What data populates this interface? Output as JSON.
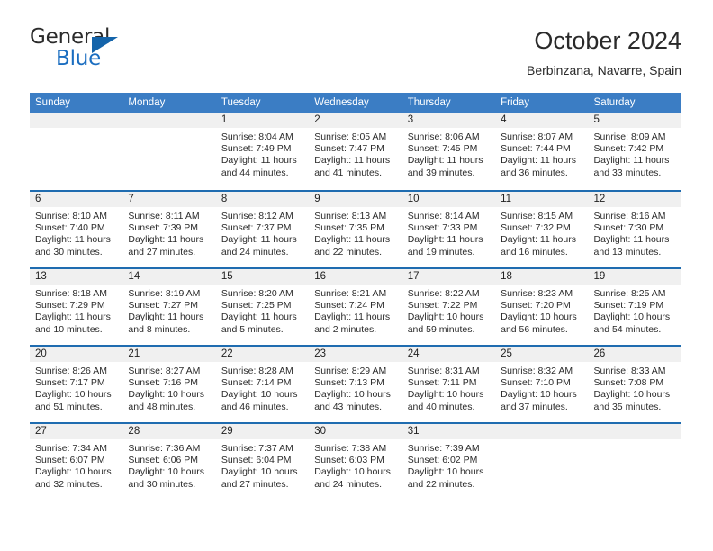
{
  "brand": {
    "name_part1": "General",
    "name_part2": "Blue",
    "accent_color": "#1a6dc0",
    "triangle_color": "#1464aa"
  },
  "header": {
    "month_title": "October 2024",
    "location": "Berbinzana, Navarre, Spain"
  },
  "calendar": {
    "header_bg": "#3b7dc4",
    "week_separator_color": "#1f6cb0",
    "day_number_bg": "#f0f0f0",
    "weekdays": [
      "Sunday",
      "Monday",
      "Tuesday",
      "Wednesday",
      "Thursday",
      "Friday",
      "Saturday"
    ],
    "weeks": [
      [
        {
          "empty": true
        },
        {
          "empty": true
        },
        {
          "day": "1",
          "sunrise": "Sunrise: 8:04 AM",
          "sunset": "Sunset: 7:49 PM",
          "daylight": "Daylight: 11 hours and 44 minutes."
        },
        {
          "day": "2",
          "sunrise": "Sunrise: 8:05 AM",
          "sunset": "Sunset: 7:47 PM",
          "daylight": "Daylight: 11 hours and 41 minutes."
        },
        {
          "day": "3",
          "sunrise": "Sunrise: 8:06 AM",
          "sunset": "Sunset: 7:45 PM",
          "daylight": "Daylight: 11 hours and 39 minutes."
        },
        {
          "day": "4",
          "sunrise": "Sunrise: 8:07 AM",
          "sunset": "Sunset: 7:44 PM",
          "daylight": "Daylight: 11 hours and 36 minutes."
        },
        {
          "day": "5",
          "sunrise": "Sunrise: 8:09 AM",
          "sunset": "Sunset: 7:42 PM",
          "daylight": "Daylight: 11 hours and 33 minutes."
        }
      ],
      [
        {
          "day": "6",
          "sunrise": "Sunrise: 8:10 AM",
          "sunset": "Sunset: 7:40 PM",
          "daylight": "Daylight: 11 hours and 30 minutes."
        },
        {
          "day": "7",
          "sunrise": "Sunrise: 8:11 AM",
          "sunset": "Sunset: 7:39 PM",
          "daylight": "Daylight: 11 hours and 27 minutes."
        },
        {
          "day": "8",
          "sunrise": "Sunrise: 8:12 AM",
          "sunset": "Sunset: 7:37 PM",
          "daylight": "Daylight: 11 hours and 24 minutes."
        },
        {
          "day": "9",
          "sunrise": "Sunrise: 8:13 AM",
          "sunset": "Sunset: 7:35 PM",
          "daylight": "Daylight: 11 hours and 22 minutes."
        },
        {
          "day": "10",
          "sunrise": "Sunrise: 8:14 AM",
          "sunset": "Sunset: 7:33 PM",
          "daylight": "Daylight: 11 hours and 19 minutes."
        },
        {
          "day": "11",
          "sunrise": "Sunrise: 8:15 AM",
          "sunset": "Sunset: 7:32 PM",
          "daylight": "Daylight: 11 hours and 16 minutes."
        },
        {
          "day": "12",
          "sunrise": "Sunrise: 8:16 AM",
          "sunset": "Sunset: 7:30 PM",
          "daylight": "Daylight: 11 hours and 13 minutes."
        }
      ],
      [
        {
          "day": "13",
          "sunrise": "Sunrise: 8:18 AM",
          "sunset": "Sunset: 7:29 PM",
          "daylight": "Daylight: 11 hours and 10 minutes."
        },
        {
          "day": "14",
          "sunrise": "Sunrise: 8:19 AM",
          "sunset": "Sunset: 7:27 PM",
          "daylight": "Daylight: 11 hours and 8 minutes."
        },
        {
          "day": "15",
          "sunrise": "Sunrise: 8:20 AM",
          "sunset": "Sunset: 7:25 PM",
          "daylight": "Daylight: 11 hours and 5 minutes."
        },
        {
          "day": "16",
          "sunrise": "Sunrise: 8:21 AM",
          "sunset": "Sunset: 7:24 PM",
          "daylight": "Daylight: 11 hours and 2 minutes."
        },
        {
          "day": "17",
          "sunrise": "Sunrise: 8:22 AM",
          "sunset": "Sunset: 7:22 PM",
          "daylight": "Daylight: 10 hours and 59 minutes."
        },
        {
          "day": "18",
          "sunrise": "Sunrise: 8:23 AM",
          "sunset": "Sunset: 7:20 PM",
          "daylight": "Daylight: 10 hours and 56 minutes."
        },
        {
          "day": "19",
          "sunrise": "Sunrise: 8:25 AM",
          "sunset": "Sunset: 7:19 PM",
          "daylight": "Daylight: 10 hours and 54 minutes."
        }
      ],
      [
        {
          "day": "20",
          "sunrise": "Sunrise: 8:26 AM",
          "sunset": "Sunset: 7:17 PM",
          "daylight": "Daylight: 10 hours and 51 minutes."
        },
        {
          "day": "21",
          "sunrise": "Sunrise: 8:27 AM",
          "sunset": "Sunset: 7:16 PM",
          "daylight": "Daylight: 10 hours and 48 minutes."
        },
        {
          "day": "22",
          "sunrise": "Sunrise: 8:28 AM",
          "sunset": "Sunset: 7:14 PM",
          "daylight": "Daylight: 10 hours and 46 minutes."
        },
        {
          "day": "23",
          "sunrise": "Sunrise: 8:29 AM",
          "sunset": "Sunset: 7:13 PM",
          "daylight": "Daylight: 10 hours and 43 minutes."
        },
        {
          "day": "24",
          "sunrise": "Sunrise: 8:31 AM",
          "sunset": "Sunset: 7:11 PM",
          "daylight": "Daylight: 10 hours and 40 minutes."
        },
        {
          "day": "25",
          "sunrise": "Sunrise: 8:32 AM",
          "sunset": "Sunset: 7:10 PM",
          "daylight": "Daylight: 10 hours and 37 minutes."
        },
        {
          "day": "26",
          "sunrise": "Sunrise: 8:33 AM",
          "sunset": "Sunset: 7:08 PM",
          "daylight": "Daylight: 10 hours and 35 minutes."
        }
      ],
      [
        {
          "day": "27",
          "sunrise": "Sunrise: 7:34 AM",
          "sunset": "Sunset: 6:07 PM",
          "daylight": "Daylight: 10 hours and 32 minutes."
        },
        {
          "day": "28",
          "sunrise": "Sunrise: 7:36 AM",
          "sunset": "Sunset: 6:06 PM",
          "daylight": "Daylight: 10 hours and 30 minutes."
        },
        {
          "day": "29",
          "sunrise": "Sunrise: 7:37 AM",
          "sunset": "Sunset: 6:04 PM",
          "daylight": "Daylight: 10 hours and 27 minutes."
        },
        {
          "day": "30",
          "sunrise": "Sunrise: 7:38 AM",
          "sunset": "Sunset: 6:03 PM",
          "daylight": "Daylight: 10 hours and 24 minutes."
        },
        {
          "day": "31",
          "sunrise": "Sunrise: 7:39 AM",
          "sunset": "Sunset: 6:02 PM",
          "daylight": "Daylight: 10 hours and 22 minutes."
        },
        {
          "empty": true
        },
        {
          "empty": true
        }
      ]
    ]
  }
}
